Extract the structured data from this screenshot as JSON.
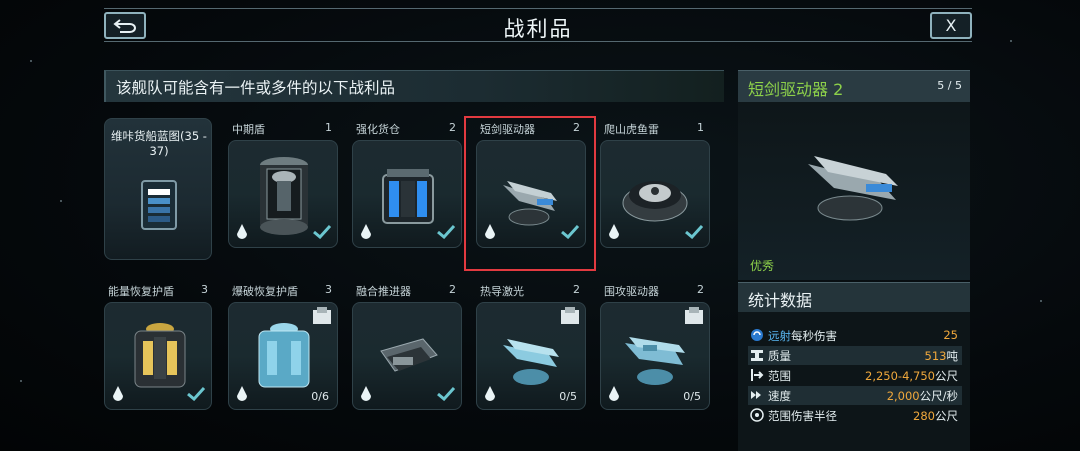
{
  "header": {
    "title": "战利品",
    "close_label": "X"
  },
  "left_panel": {
    "heading": "该舰队可能含有一件或多件的以下战利品",
    "blueprint": {
      "label": "维咔货船蓝图(35 - 37)"
    },
    "items_row1": [
      {
        "name": "中期盾",
        "count": "1",
        "status": "check"
      },
      {
        "name": "强化货仓",
        "count": "2",
        "status": "check"
      },
      {
        "name": "短剑驱动器",
        "count": "2",
        "status": "check",
        "selected": true
      },
      {
        "name": "爬山虎鱼雷",
        "count": "1",
        "status": "check"
      }
    ],
    "items_row2": [
      {
        "name": "能量恢复护盾",
        "count": "3",
        "status": "check"
      },
      {
        "name": "爆破恢复护盾",
        "count": "3",
        "status": "fraction",
        "fraction": "0/6"
      },
      {
        "name": "融合推进器",
        "count": "2",
        "status": "check"
      },
      {
        "name": "热导激光",
        "count": "2",
        "status": "fraction",
        "fraction": "0/5"
      },
      {
        "name": "围攻驱动器",
        "count": "2",
        "status": "fraction",
        "fraction": "0/5"
      }
    ]
  },
  "detail_panel": {
    "title": "短剑驱动器 2",
    "count": "5 / 5",
    "rarity": "优秀",
    "stats_heading": "统计数据",
    "stats": [
      {
        "label_prefix": "远射",
        "label": "每秒伤害",
        "value": "25",
        "unit": "",
        "icon": "range-icon"
      },
      {
        "label_prefix": "",
        "label": "质量",
        "value": "513",
        "unit": "吨",
        "icon": "mass-icon"
      },
      {
        "label_prefix": "",
        "label": "范围",
        "value": "2,250-4,750",
        "unit": "公尺",
        "icon": "range-arrow-icon"
      },
      {
        "label_prefix": "",
        "label": "速度",
        "value": "2,000",
        "unit": "公尺/秒",
        "icon": "speed-icon"
      },
      {
        "label_prefix": "",
        "label": "范围伤害半径",
        "value": "280",
        "unit": "公尺",
        "icon": "radius-icon"
      }
    ]
  },
  "colors": {
    "accent_green": "#8dd14a",
    "value_orange": "#f0a83c",
    "selection_red": "#e23a40",
    "check_teal": "#6bc6cf"
  }
}
